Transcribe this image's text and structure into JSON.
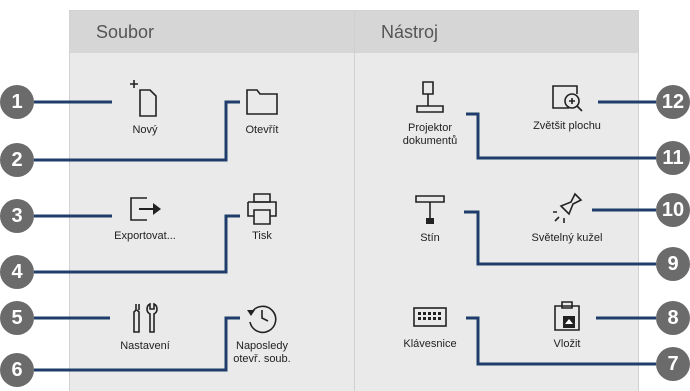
{
  "sections": {
    "file_header": "Soubor",
    "tools_header": "Nástroj"
  },
  "items": {
    "new": "Nový",
    "open": "Otevřít",
    "export": "Exportovat...",
    "print": "Tisk",
    "settings": "Nastavení",
    "recent_line1": "Naposledy",
    "recent_line2": "otevř. soub.",
    "doc_camera_line1": "Projektor",
    "doc_camera_line2": "dokumentů",
    "zoom": "Zvětšit plochu",
    "shade": "Stín",
    "spotlight": "Světelný kužel",
    "keyboard": "Klávesnice",
    "paste": "Vložit"
  },
  "callouts": [
    "1",
    "2",
    "3",
    "4",
    "5",
    "6",
    "7",
    "8",
    "9",
    "10",
    "11",
    "12"
  ],
  "colors": {
    "badge": "#6b6b6b",
    "line": "#1f3d6b",
    "header_bg": "#d6d6d6",
    "panel_bg": "#eaeaea"
  }
}
